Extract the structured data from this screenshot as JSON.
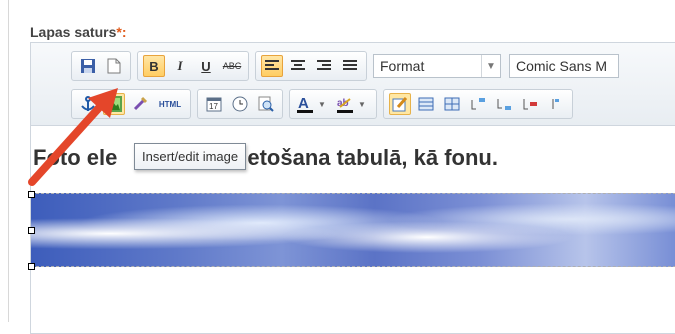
{
  "field": {
    "label": "Lapas saturs",
    "required_mark": "*:"
  },
  "toolbar": {
    "format_select": "Format",
    "font_select": "Comic Sans M",
    "html_button": "HTML",
    "bold": "B",
    "italic": "I",
    "underline": "U",
    "strike": "ABC"
  },
  "content": {
    "heading": "Foto ele",
    "heading_rest": "etošana tabulā, kā fonu."
  },
  "tooltip": {
    "text": "Insert/edit image"
  },
  "colors": {
    "accent_arrow": "#e4462a",
    "active_button": "#ffcd62"
  }
}
